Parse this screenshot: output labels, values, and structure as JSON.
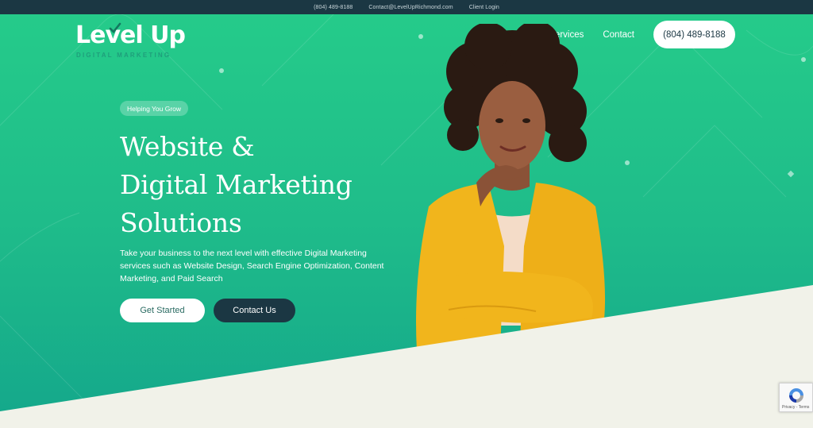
{
  "topbar": {
    "phone": "(804) 489-8188",
    "email": "Contact@LevelUpRichmond.com",
    "login": "Client Login"
  },
  "brand": {
    "name": "Level Up",
    "tagline": "DIGITAL MARKETING"
  },
  "nav": {
    "services": "Services",
    "contact": "Contact",
    "phone_button": "(804) 489-8188"
  },
  "hero": {
    "pill": "Helping You Grow",
    "headline_lines": [
      "Website &",
      "Digital  Marketing",
      "Solutions"
    ],
    "lead": "Take your business to the next level with effective Digital Marketing services such as Website Design, Search Engine Optimization, Content Marketing, and Paid Search",
    "primary_button": "Get Started",
    "secondary_button": "Contact Us"
  },
  "recaptcha": {
    "footer": "Privacy - Terms"
  },
  "colors": {
    "topbar_bg": "#1b3743",
    "hero_green": "#25cb8a",
    "navy": "#1b3743",
    "cream": "#f1f2e9",
    "jacket_yellow": "#f1b51c"
  },
  "icons": {
    "logo_check": "checkmark-arrow-icon",
    "recaptcha": "recaptcha-icon"
  }
}
